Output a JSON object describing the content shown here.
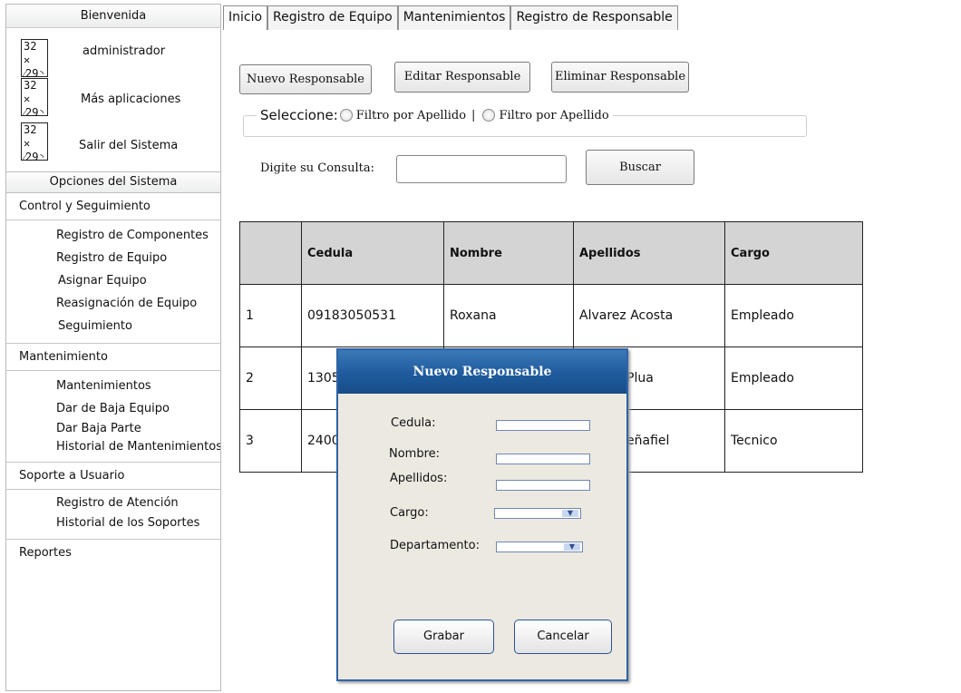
{
  "sidebar": {
    "header": "Bienvenida",
    "icon_text_top": "32",
    "icon_text_bottom": "29",
    "links": [
      "administrador",
      "Más aplicaciones",
      "Salir del Sistema"
    ],
    "options_header": "Opciones del Sistema",
    "groups": [
      {
        "title": "Control y Seguimiento",
        "items": [
          "Registro de Componentes",
          "Registro de Equipo",
          "Asignar Equipo",
          "Reasignación de Equipo",
          "Seguimiento"
        ]
      },
      {
        "title": "Mantenimiento",
        "items": [
          "Mantenimientos",
          "Dar de Baja Equipo",
          "Dar Baja Parte",
          "Historial de Mantenimientos"
        ]
      },
      {
        "title": "Soporte a Usuario",
        "items": [
          "Registro de Atención",
          "Historial de los Soportes"
        ]
      },
      {
        "title": "Reportes",
        "items": []
      }
    ]
  },
  "tabs": [
    "Inicio",
    "Registro de Equipo",
    "Mantenimientos",
    "Registro de Responsable"
  ],
  "toolbar": {
    "new": "Nuevo Responsable",
    "edit": "Editar Responsable",
    "delete": "Eliminar Responsable"
  },
  "filter": {
    "label": "Seleccione:",
    "option1": "Filtro por Apellido",
    "separator": "|",
    "option2": "Filtro por Apellido"
  },
  "query": {
    "label": "Digite su Consulta:",
    "value": "",
    "search_button": "Buscar"
  },
  "table": {
    "headers": [
      "",
      "Cedula",
      "Nombre",
      "Apellidos",
      "Cargo"
    ],
    "rows": [
      [
        "1",
        "09183050531",
        "Roxana",
        "Alvarez Acosta",
        "Empleado"
      ],
      [
        "2",
        "1305",
        "",
        "Plua",
        "Empleado"
      ],
      [
        "3",
        "2400",
        "",
        "eñafiel",
        "Tecnico"
      ]
    ]
  },
  "dialog": {
    "title": "Nuevo Responsable",
    "fields": {
      "cedula": "Cedula:",
      "nombre": "Nombre:",
      "apellidos": "Apellidos:",
      "cargo": "Cargo:",
      "departamento": "Departamento:"
    },
    "save": "Grabar",
    "cancel": "Cancelar"
  }
}
